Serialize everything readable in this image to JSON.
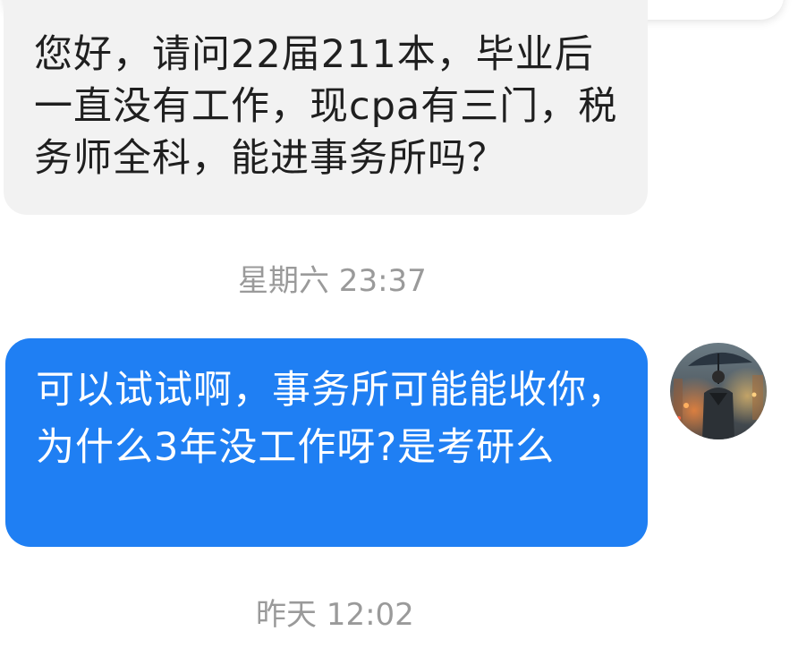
{
  "messages": {
    "incoming": {
      "text": "您好，请问22届211本，毕业后一直没有工作，现cpa有三门，税务师全科，能进事务所吗？"
    },
    "timestamp_1": "星期六 23:37",
    "outgoing": {
      "text": "可以试试啊，事务所可能能收你，为什么3年没工作呀?是考研么"
    },
    "timestamp_2": "昨天 12:02"
  },
  "avatar": {
    "icon": "person-with-umbrella-avatar"
  },
  "colors": {
    "incoming_bubble": "#f2f2f2",
    "outgoing_bubble": "#1f7ff3",
    "timestamp": "#9a9a9a",
    "incoming_text": "#1f1f1f",
    "outgoing_text": "#ffffff"
  }
}
